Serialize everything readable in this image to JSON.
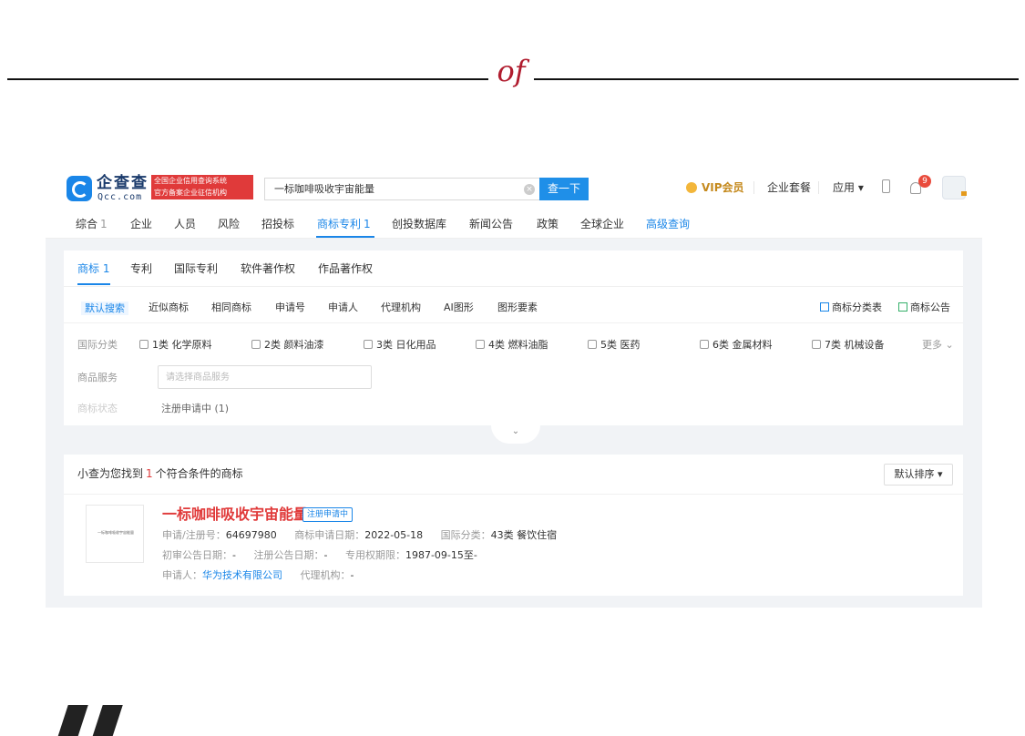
{
  "decor": {
    "ornament": "of"
  },
  "topbar": {
    "logo_cn": "企查查",
    "logo_en": "Qcc.com",
    "badge_line1": "全国企业信用查询系统",
    "badge_line2": "官方备案企业征信机构",
    "search_value": "一标咖啡吸收宇宙能量",
    "search_button": "查一下",
    "vip_label": "VIP会员",
    "enterprise_package": "企业套餐",
    "apps_label": "应用",
    "notification_count": "9"
  },
  "categories": [
    {
      "label": "综合",
      "count": "1"
    },
    {
      "label": "企业",
      "count": ""
    },
    {
      "label": "人员",
      "count": ""
    },
    {
      "label": "风险",
      "count": ""
    },
    {
      "label": "招投标",
      "count": ""
    },
    {
      "label": "商标专利",
      "count": "1"
    },
    {
      "label": "创投数据库",
      "count": ""
    },
    {
      "label": "新闻公告",
      "count": ""
    },
    {
      "label": "政策",
      "count": ""
    },
    {
      "label": "全球企业",
      "count": ""
    },
    {
      "label": "高级查询",
      "count": ""
    }
  ],
  "panel": {
    "sub_tabs": [
      {
        "label": "商标",
        "count": "1"
      },
      {
        "label": "专利",
        "count": ""
      },
      {
        "label": "国际专利",
        "count": ""
      },
      {
        "label": "软件著作权",
        "count": ""
      },
      {
        "label": "作品著作权",
        "count": ""
      }
    ],
    "search_modes": [
      "默认搜索",
      "近似商标",
      "相同商标",
      "申请号",
      "申请人",
      "代理机构",
      "AI图形",
      "图形要素"
    ],
    "right_links": [
      "商标分类表",
      "商标公告"
    ],
    "class_label": "国际分类",
    "classes": [
      "1类 化学原料",
      "2类 颜料油漆",
      "3类 日化用品",
      "4类 燃料油脂",
      "5类 医药",
      "6类 金属材料",
      "7类 机械设备"
    ],
    "more_label": "更多",
    "goods_label": "商品服务",
    "goods_placeholder": "请选择商品服务",
    "status_label": "商标状态",
    "status_option": "注册申请中 (1)"
  },
  "results": {
    "summary_prefix": "小查为您找到",
    "summary_count": "1",
    "summary_suffix": "个符合条件的商标",
    "sort_label": "默认排序",
    "item": {
      "thumb_text": "一标咖啡吸收宇宙能量",
      "title": "一标咖啡吸收宇宙能量",
      "status": "注册申请中",
      "reg_no_label": "申请/注册号：",
      "reg_no": "64697980",
      "apply_date_label": "商标申请日期：",
      "apply_date": "2022-05-18",
      "intl_class_label": "国际分类：",
      "intl_class": "43类 餐饮住宿",
      "first_pub_label": "初审公告日期：",
      "first_pub": "-",
      "reg_pub_label": "注册公告日期：",
      "reg_pub": "-",
      "exclusive_label": "专用权期限：",
      "exclusive": "1987-09-15至-",
      "applicant_label": "申请人：",
      "applicant": "华为技术有限公司",
      "agency_label": "代理机构：",
      "agency": "-"
    }
  }
}
